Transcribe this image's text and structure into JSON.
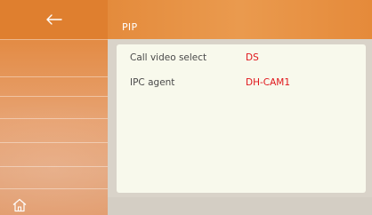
{
  "header": {
    "title": "PIP"
  },
  "sidebar": {
    "back_icon": "back-arrow-icon",
    "home_icon": "home-icon"
  },
  "settings": [
    {
      "label": "Call video select",
      "value": "DS"
    },
    {
      "label": "IPC agent",
      "value": "DH-CAM1"
    }
  ],
  "colors": {
    "accent": "#e58a3c",
    "value_text": "#e0161b",
    "panel_bg": "#f8f9ec"
  }
}
